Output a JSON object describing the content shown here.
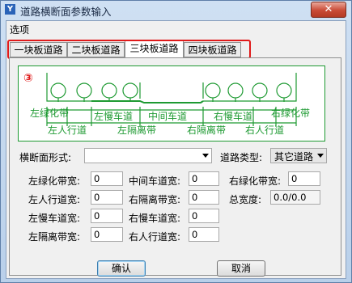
{
  "window": {
    "title": "道路横断面参数输入",
    "close": "✕"
  },
  "menu": {
    "options": "选项"
  },
  "tabs": [
    "一块板道路",
    "二块板道路",
    "三块板道路",
    "四块板道路"
  ],
  "diagram": {
    "number": "③",
    "labels": {
      "left_green": "左绿化带",
      "left_slow": "左慢车道",
      "middle": "中间车道",
      "right_slow": "右慢车道",
      "right_green": "右绿化带",
      "left_walk": "左人行道",
      "left_sep": "左隔离带",
      "right_sep": "右隔离带",
      "right_walk": "右人行道"
    },
    "line_color": "#1e9a32"
  },
  "form": {
    "section_form_label": "横断面形式:",
    "section_form_value": "",
    "road_type_label": "道路类型:",
    "road_type_value": "其它道路",
    "fields": {
      "left_green_label": "左绿化带宽:",
      "left_green_value": "0",
      "mid_lane_label": "中间车道宽:",
      "mid_lane_value": "0",
      "right_green_label": "右绿化带宽:",
      "right_green_value": "0",
      "left_walk_label": "左人行道宽:",
      "left_walk_value": "0",
      "right_sep_label": "右隔离带宽:",
      "right_sep_value": "0",
      "total_label": "总宽度:",
      "total_value": "0.0/0.0",
      "left_slow_label": "左慢车道宽:",
      "left_slow_value": "0",
      "right_slow_label": "右慢车道宽:",
      "right_slow_value": "0",
      "left_sep_label": "左隔离带宽:",
      "left_sep_value": "0",
      "right_walk_label": "右人行道宽:",
      "right_walk_value": "0"
    }
  },
  "buttons": {
    "ok": "确认",
    "cancel": "取消"
  }
}
